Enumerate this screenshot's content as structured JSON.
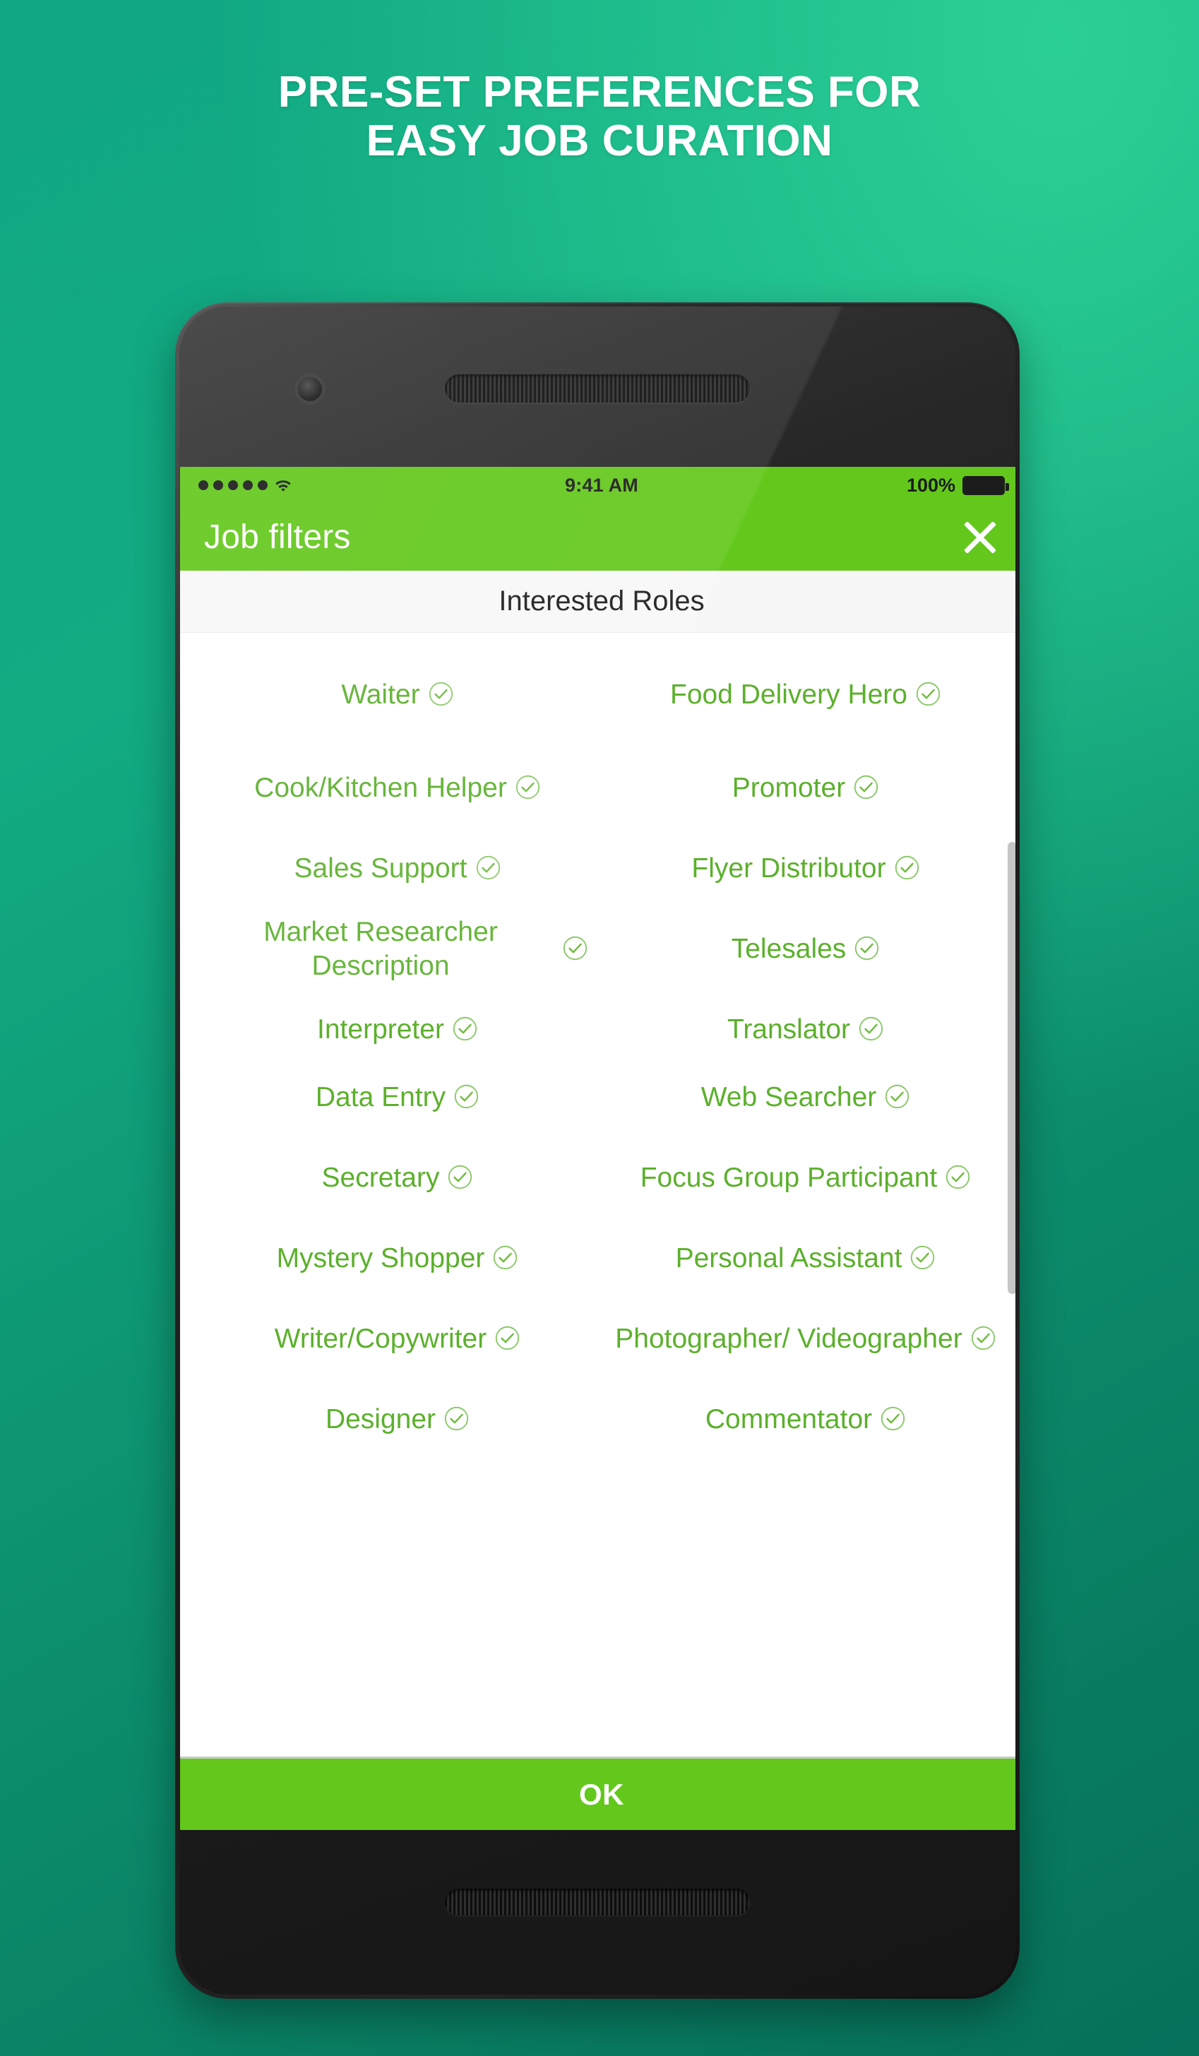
{
  "headline": {
    "line1": "PRE-SET PREFERENCES FOR",
    "line2": "EASY JOB CURATION"
  },
  "colors": {
    "bg_top_left": "#11a883",
    "bg_top_right": "#22c08c",
    "bg_bottom_left": "#067059",
    "brand_green": "#63c81b",
    "item_green": "#5cb02c",
    "screen_white": "#ffffff",
    "section_bg": "#f7f7f7",
    "scrollbar": "#c6c6c6"
  },
  "status_bar": {
    "signal_dots": 5,
    "wifi_icon": "wifi-icon",
    "time": "9:41 AM",
    "battery_percent": "100%",
    "battery_icon": "battery-full-icon"
  },
  "app_bar": {
    "title": "Job filters",
    "close_icon": "close-icon"
  },
  "section": {
    "title": "Interested Roles"
  },
  "roles": [
    {
      "label": "Waiter",
      "checked": true,
      "two_line": false
    },
    {
      "label": "Food Delivery Hero",
      "checked": true,
      "two_line": true
    },
    {
      "label": "Cook/Kitchen Helper",
      "checked": true,
      "two_line": true
    },
    {
      "label": "Promoter",
      "checked": true,
      "two_line": false
    },
    {
      "label": "Sales Support",
      "checked": true,
      "two_line": false
    },
    {
      "label": "Flyer Distributor",
      "checked": true,
      "two_line": false
    },
    {
      "label": "Market Researcher Description",
      "checked": true,
      "two_line": true
    },
    {
      "label": "Telesales",
      "checked": true,
      "two_line": false
    },
    {
      "label": "Interpreter",
      "checked": true,
      "two_line": false
    },
    {
      "label": "Translator",
      "checked": true,
      "two_line": false
    },
    {
      "label": "Data Entry",
      "checked": true,
      "two_line": false
    },
    {
      "label": "Web Searcher",
      "checked": true,
      "two_line": false
    },
    {
      "label": "Secretary",
      "checked": true,
      "two_line": false
    },
    {
      "label": "Focus Group Participant",
      "checked": true,
      "two_line": true
    },
    {
      "label": "Mystery Shopper",
      "checked": true,
      "two_line": false
    },
    {
      "label": "Personal Assistant",
      "checked": true,
      "two_line": false
    },
    {
      "label": "Writer/Copywriter",
      "checked": true,
      "two_line": false
    },
    {
      "label": "Photographer/ Videographer",
      "checked": true,
      "two_line": true
    },
    {
      "label": "Designer",
      "checked": true,
      "two_line": false
    },
    {
      "label": "Commentator",
      "checked": true,
      "two_line": false
    }
  ],
  "footer": {
    "ok_label": "OK"
  },
  "device": {
    "camera_icon": "front-camera-icon",
    "speaker_top_icon": "earpiece-speaker-icon",
    "speaker_bottom_icon": "loudspeaker-icon",
    "power_button": "power-button",
    "volume_button": "volume-button"
  }
}
